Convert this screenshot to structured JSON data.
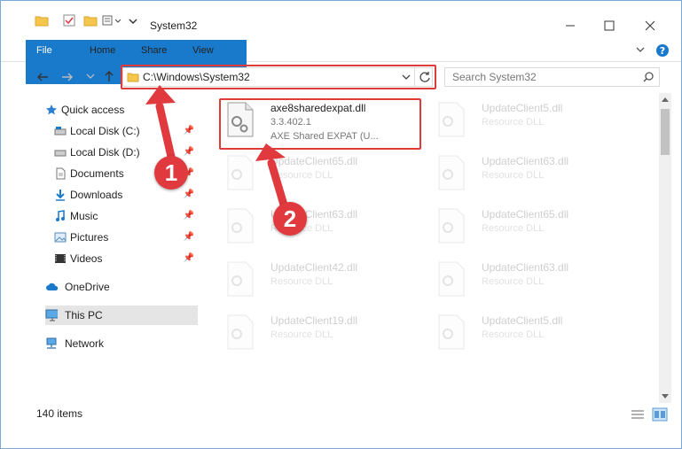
{
  "window": {
    "title": "System32"
  },
  "ribbon": {
    "tabs": [
      "File",
      "Home",
      "Share",
      "View"
    ]
  },
  "address": {
    "path": "C:\\Windows\\System32"
  },
  "search": {
    "placeholder": "Search System32"
  },
  "nav": {
    "items": [
      {
        "label": "Quick access",
        "icon": "star-icon",
        "pinned": false
      },
      {
        "label": "Local Disk (C:)",
        "icon": "drive-icon",
        "pinned": true
      },
      {
        "label": "Local Disk (D:)",
        "icon": "drive-icon",
        "pinned": true
      },
      {
        "label": "Documents",
        "icon": "document-icon",
        "pinned": true
      },
      {
        "label": "Downloads",
        "icon": "download-icon",
        "pinned": true
      },
      {
        "label": "Music",
        "icon": "music-icon",
        "pinned": true
      },
      {
        "label": "Pictures",
        "icon": "picture-icon",
        "pinned": true
      },
      {
        "label": "Videos",
        "icon": "video-icon",
        "pinned": true
      },
      {
        "label": "OneDrive",
        "icon": "cloud-icon",
        "pinned": false
      },
      {
        "label": "This PC",
        "icon": "computer-icon",
        "pinned": false
      },
      {
        "label": "Network",
        "icon": "network-icon",
        "pinned": false
      }
    ]
  },
  "files": [
    {
      "name": "axe8sharedexpat.dll",
      "version": "3.3.402.1",
      "desc": "AXE Shared EXPAT (U..."
    },
    {
      "name": "UpdateClient5.dll",
      "desc": "Resource DLL"
    },
    {
      "name": "UpdateClient65.dll",
      "desc": "Resource DLL"
    },
    {
      "name": "UpdateClient63.dll",
      "desc": "Resource DLL"
    },
    {
      "name": "UpdateClient63.dll",
      "desc": "Resource DLL"
    },
    {
      "name": "UpdateClient65.dll",
      "desc": "Resource DLL"
    },
    {
      "name": "UpdateClient42.dll",
      "desc": "Resource DLL"
    },
    {
      "name": "UpdateClient63.dll",
      "desc": "Resource DLL"
    },
    {
      "name": "UpdateClient19.dll",
      "desc": "Resource DLL"
    },
    {
      "name": "UpdateClient5.dll",
      "desc": "Resource DLL"
    }
  ],
  "status": {
    "items": "140 items"
  },
  "markers": [
    "1",
    "2"
  ],
  "colors": {
    "accent": "#1979ca",
    "highlight": "#e03b3b"
  }
}
